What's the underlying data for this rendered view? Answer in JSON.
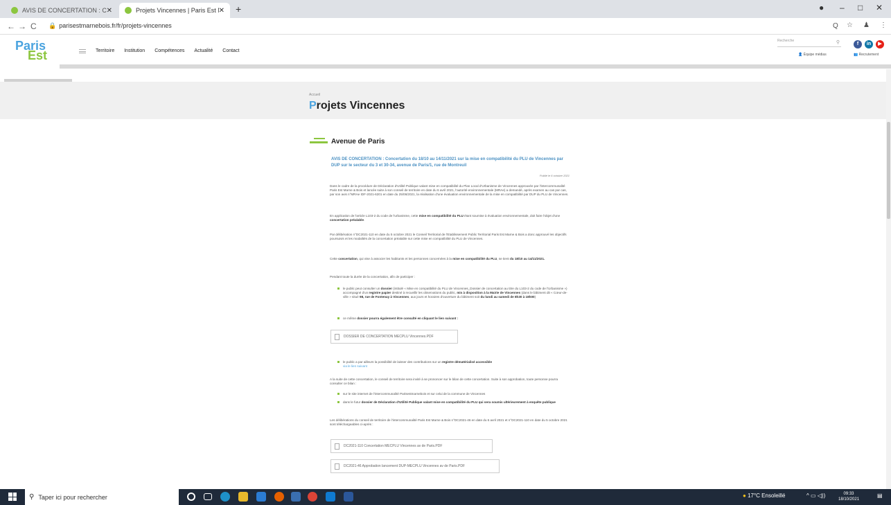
{
  "browser": {
    "tabs": [
      {
        "label": "AVIS DE CONCERTATION : Conce",
        "close": "✕"
      },
      {
        "label": "Projets Vincennes | Paris Est Mar",
        "close": "✕"
      }
    ],
    "new_tab": "+",
    "url": "parisestmarnebois.fr/fr/projets-vincennes",
    "nav": {
      "back": "←",
      "forward": "→",
      "reload": "C"
    },
    "window": {
      "profile": "●",
      "minimize": "–",
      "maximize": "□",
      "close": "✕"
    },
    "right_icons": {
      "zoom": "Q",
      "star": "☆",
      "account": "♟",
      "menu": "⋮"
    }
  },
  "site": {
    "logo": {
      "top": "Paris",
      "bottom": "Est"
    },
    "menu": [
      "Territoire",
      "Institution",
      "Compétences",
      "Actualité",
      "Contact"
    ],
    "search_placeholder": "Recherche",
    "social": {
      "facebook": "f",
      "linkedin": "in",
      "youtube": "▶"
    },
    "header_links": {
      "team": "Équipe médias",
      "recruit": "Recrutement"
    },
    "breadcrumb": "Accueil",
    "page_title_first": "P",
    "page_title_rest": "rojets Vincennes"
  },
  "article": {
    "section": "Avenue de Paris",
    "title": "AVIS DE CONCERTATION : Concertation du 18/10 au 14/11/2021 sur la mise en compatibilité du PLU de Vincennes par DUP sur le secteur du 3 et 30-34, avenue de Paris/1, rue de Montreuil",
    "published": "Publié le 6 octobre 2021",
    "p1": "Dans le cadre de la procédure de Déclaration d'Utilité Publique valant mise en compatibilité du Plan Local d'Urbanisme de Vincennes approuvée par l'intercommunalité Paris Est Marne & Bois et lancée suite à son conseil de territoire en date du 6 avril 2021, l'autorité environnementale (MRAe) a demandé, après examen au cas par cas, par son avis n°MRAe IDF-2021-6201 en date du 25/06/2021, la réalisation d'une évaluation environnementale de la mise en compatibilité par DUP du PLU de Vincennes.",
    "p2_a": "En application de l'article L103-2 du code de l'urbanisme, cette",
    "p2_b": "mise en compatibilité du PLU",
    "p2_c": "étant soumise à évaluation environnementale, doit faire l'objet d'une",
    "p2_d": "concertation préalable",
    "p3": "Par délibération n°DC2021-110 en date du 5 octobre 2021 le Conseil Territorial de l'Etablissement Public Territorial Paris Est Marne & Bois a donc approuvé les objectifs poursuivis et les modalités de la concertation préalable sur cette mise en compatibilité du PLU de Vincennes.",
    "p4_a": "Cette",
    "p4_b": "concertation",
    "p4_c": ", qui vise à associer les habitants et les personnes concernées à la",
    "p4_d": "mise en compatibilité du PLU",
    "p4_e": ", se tient",
    "p4_f": "du 18/10 au 14/11/2021.",
    "p5": "Pendant toute la durée de la concertation, afin de participer :",
    "b1_a": "le public peut consulter un",
    "b1_b": "dossier",
    "b1_c": "(intitulé « Mise en compatibilité du PLU de Vincennes_Dossier de concertation au titre du L103-2 du code de l'Urbanisme ») accompagné d'un",
    "b1_d": "registre papier",
    "b1_e": "destiné à recueillir les observations du public,",
    "b1_f": "mis à disposition à la Mairie de Vincennes",
    "b1_g": "(dans le bâtiment dit « Cœur-de-ville » situé",
    "b1_h": "98, rue de Fontenay à Vincennes",
    "b1_i": ", aux jours et horaires d'ouverture du bâtiment soit",
    "b1_j": "du lundi au samedi de 8h30 à 18h00",
    "b2_a": "ce même",
    "b2_b": "dossier pourra également être consulté en cliquant le lien suivant :",
    "dl1": "DOSSIER DE CONCERTATION MECPLU Vincennes.PDF",
    "b3_a": "le public a par ailleurs la possibilité de laisser des contributions sur un",
    "b3_b": "registre dématérialisé accessible",
    "b3_c": "via le lien suivant",
    "p6": "A la suite de cette concertation, le conseil de territoire sera invité à se prononcer sur le bilan de cette concertation. Suite à son approbation, toute personne pourra consulter ce bilan :",
    "b4": "sur le site internet de l'intercommunalité Parisestmarnebois et sur celui de la commune de Vincennes",
    "b5_a": "dans le futur",
    "b5_b": "dossier de Déclaration d'Utilité Publique valant mise en compatibilité du PLU qui sera soumis",
    "b5_c": "ultérieurement à enquête publique",
    "p7": "Les délibérations du conseil de territoire de l'intercommunalité Paris Est Marne & Bois n°DC2021-46 en date du 6 avril 2021 et n°DC2021-110 en date du 5 octobre 2021 sont téléchargeables ci-après :",
    "dl2": "DC2021-110 Concertation MECPLU Vincennes av de Paris.PDF",
    "dl3": "DC2021-46 Approbation lancement DUP-MECPLU Vincennes av de Paris.PDF"
  },
  "taskbar": {
    "search_placeholder": "Taper ici pour rechercher",
    "weather": "17°C Ensoleillé",
    "time": "09:33",
    "date": "18/10/2021"
  }
}
